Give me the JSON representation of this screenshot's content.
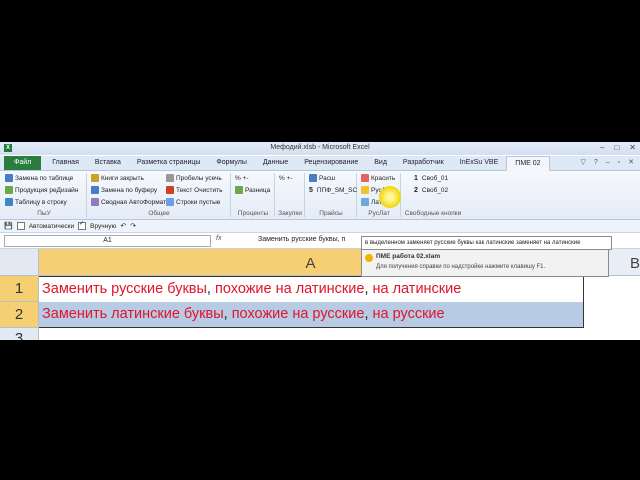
{
  "window": {
    "title": "Мефодий.xlsb - Microsoft Excel",
    "app_icon": "X"
  },
  "tabs": [
    "Файл",
    "Главная",
    "Вставка",
    "Разметка страницы",
    "Формулы",
    "Данные",
    "Рецензирование",
    "Вид",
    "Разработчик",
    "InExSu VBE",
    "ПМЕ 02"
  ],
  "groups": {
    "pyu": {
      "label": "ПыУ",
      "items": [
        "Замена по таблице",
        "Продукция реДизайн",
        "Таблицу в строку"
      ]
    },
    "common": {
      "label": "Общее",
      "col1": [
        "Книги закрыть",
        "Замена по буферу",
        "Сводная АвтоФормат"
      ],
      "col2": [
        "Пробелы усечь",
        "Текст Очистить",
        "Строки пустые"
      ]
    },
    "percent": {
      "label": "Проценты",
      "items": [
        "% +-",
        "Разница"
      ]
    },
    "purchases": {
      "label": "Закупки",
      "items": [
        "% +-"
      ]
    },
    "prices": {
      "label": "Прайсы",
      "items": [
        "Расш",
        "ППФ_SM_SC"
      ],
      "num": "5"
    },
    "ruslat": {
      "label": "РусЛат",
      "items": [
        "Красить",
        "РусЛат",
        "ЛатРус"
      ]
    },
    "free": {
      "label": "Свободные кнопки",
      "items": [
        "Своб_01",
        "Своб_02"
      ],
      "nums": [
        "1",
        "2"
      ]
    }
  },
  "qat": {
    "auto_label": "Автоматически",
    "manual_label": "Вручную"
  },
  "formula_bar": {
    "name_box": "A1",
    "fx": "fx",
    "formula": "Заменить русские буквы, п"
  },
  "tooltip": {
    "line": "в выделенном заменяет русские буквы как латинские заменяет на латинские",
    "title": "ПМЕ работа 02.xlam",
    "hint": "Для получения справки по надстройке нажмите клавишу F1."
  },
  "grid": {
    "col_a": "A",
    "col_b": "B",
    "rows": [
      {
        "num": "1",
        "parts": [
          "Заменить русские буквы",
          ", ",
          "похожие на латинские",
          ", ",
          "на латинские"
        ]
      },
      {
        "num": "2",
        "parts": [
          "Заменить латинские буквы",
          ", ",
          "похожие на русские",
          ", ",
          "на русские"
        ]
      },
      {
        "num": "3"
      }
    ]
  }
}
